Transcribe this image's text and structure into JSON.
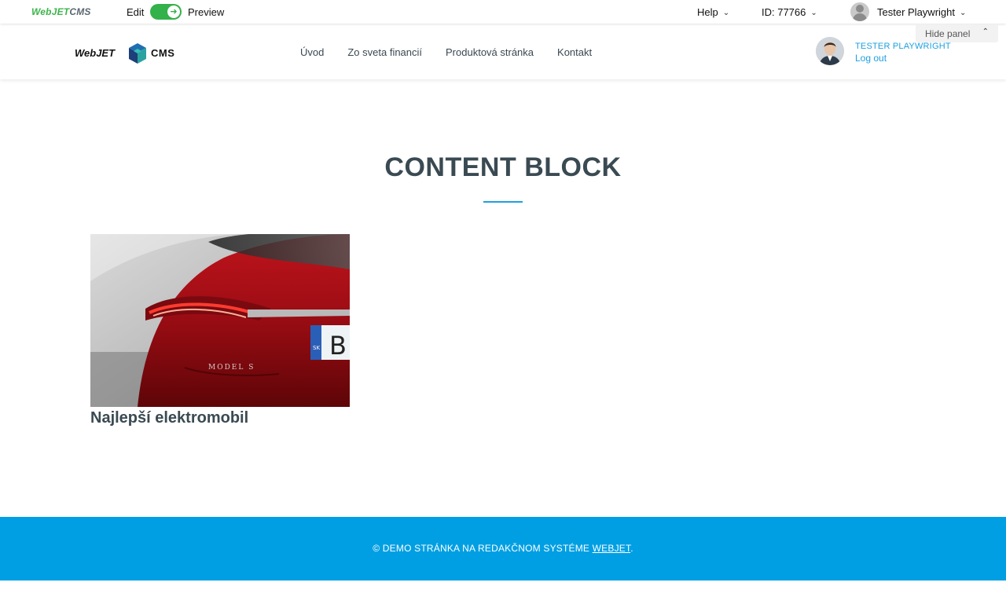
{
  "admin_bar": {
    "logo_part1": "WebJET",
    "logo_part2": "CMS",
    "edit_label": "Edit",
    "preview_label": "Preview",
    "help_label": "Help",
    "id_label": "ID: 77766",
    "user_name": "Tester Playwright",
    "hide_panel_label": "Hide panel"
  },
  "header": {
    "logo_word1": "WebJET",
    "logo_word2": "CMS",
    "nav": [
      "Úvod",
      "Zo sveta financií",
      "Produktová stránka",
      "Kontakt"
    ],
    "profile_name": "TESTER PLAYWRIGHT",
    "logout_label": "Log out"
  },
  "main": {
    "title": "CONTENT BLOCK",
    "card": {
      "title": "Najlepší elektromobil"
    }
  },
  "footer": {
    "text_prefix": "© DEMO STRÁNKA NA REDAKČNOM SYSTÉME ",
    "link_label": "WEBJET",
    "text_suffix": "."
  },
  "colors": {
    "accent": "#1ea0e0",
    "footer_bg": "#009fe3",
    "toggle_green": "#33b14a",
    "title_text": "#3a4a52"
  },
  "icons": [
    "arrow-right-icon",
    "chevron-down-icon",
    "user-icon",
    "chevron-up-icon",
    "cube-logo-icon"
  ]
}
